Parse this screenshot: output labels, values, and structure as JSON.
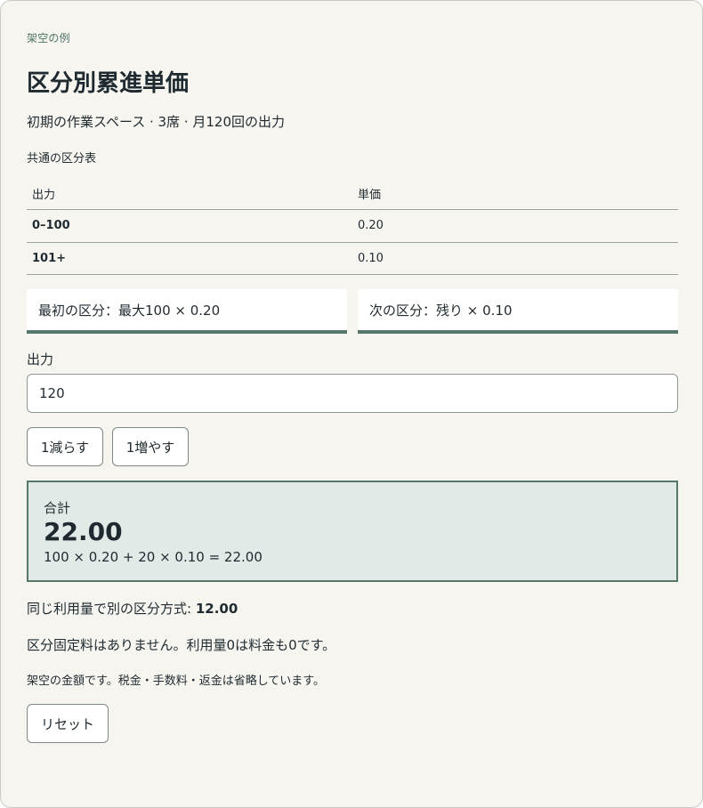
{
  "eyebrow": "架空の例",
  "title": "区分別累進単価",
  "subtitle": "初期の作業スペース · 3席 · 月120回の出力",
  "table": {
    "caption": "共通の区分表",
    "headers": [
      "出力",
      "単価"
    ],
    "rows": [
      {
        "range": "0–100",
        "price": "0.20"
      },
      {
        "range": "101+",
        "price": "0.10"
      }
    ]
  },
  "tier_cards": [
    "最初の区分：最大100 × 0.20",
    "次の区分：残り × 0.10"
  ],
  "quantity": {
    "label": "出力",
    "value": "120"
  },
  "buttons": {
    "decrement": "1減らす",
    "increment": "1増やす",
    "reset": "リセット"
  },
  "total": {
    "label": "合計",
    "value": "22.00",
    "formula": "100 × 0.20 + 20 × 0.10 = 22.00"
  },
  "alternative": {
    "label": "同じ利用量で別の区分方式: ",
    "value": "12.00"
  },
  "note": "区分固定料はありません。利用量0は料金も0です。",
  "disclaimer": "架空の金額です。税金・手数料・返金は省略しています。",
  "colors": {
    "accent": "#54796c",
    "total_bg": "#e1eae6",
    "card_bg": "#f6f5f0"
  }
}
